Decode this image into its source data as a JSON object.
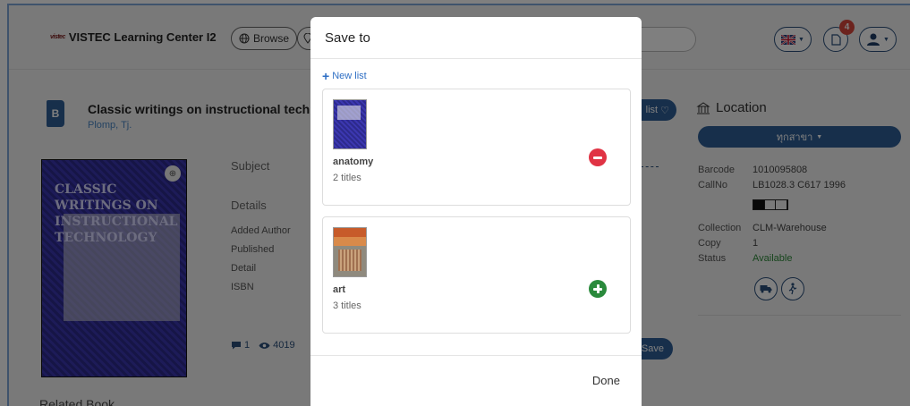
{
  "header": {
    "logo_mark": "vistec",
    "app_title": "VISTEC Learning Center I2",
    "browse_label": "Browse",
    "notification_count": "4"
  },
  "book": {
    "title": "Classic writings on instructional technology",
    "title_visible": "Classic writings on instructional techno",
    "author": "Plomp, Tj.",
    "cover_text": "CLASSIC WRITINGS ON INSTRUCTIONAL TECHNOLOGY",
    "subject_label": "Subject",
    "details_label": "Details",
    "fields": [
      "Added Author",
      "Published",
      "Detail",
      "ISBN"
    ],
    "reviews_count": "1",
    "views_count": "4019",
    "related_label": "Related Book"
  },
  "actions": {
    "add_list_label": "list",
    "save_label": "Save"
  },
  "location": {
    "title": "Location",
    "branch_button": "ทุกสาขา",
    "barcode_key": "Barcode",
    "barcode_val": "1010095808",
    "callno_key": "CallNo",
    "callno_val": "LB1028.3 C617 1996",
    "collection_key": "Collection",
    "collection_val": "CLM-Warehouse",
    "copy_key": "Copy",
    "copy_val": "1",
    "status_key": "Status",
    "status_val": "Available"
  },
  "modal": {
    "title": "Save to",
    "new_list_label": "New list",
    "lists": [
      {
        "name": "anatomy",
        "count": "2 titles",
        "action": "remove"
      },
      {
        "name": "art",
        "count": "3 titles",
        "action": "add"
      }
    ],
    "done_label": "Done"
  },
  "colors": {
    "primary": "#2f5f96",
    "link": "#2f6fc4",
    "remove": "#e03344",
    "add": "#2a8a3c",
    "available": "#2e8b3a",
    "badge": "#d9473d"
  }
}
